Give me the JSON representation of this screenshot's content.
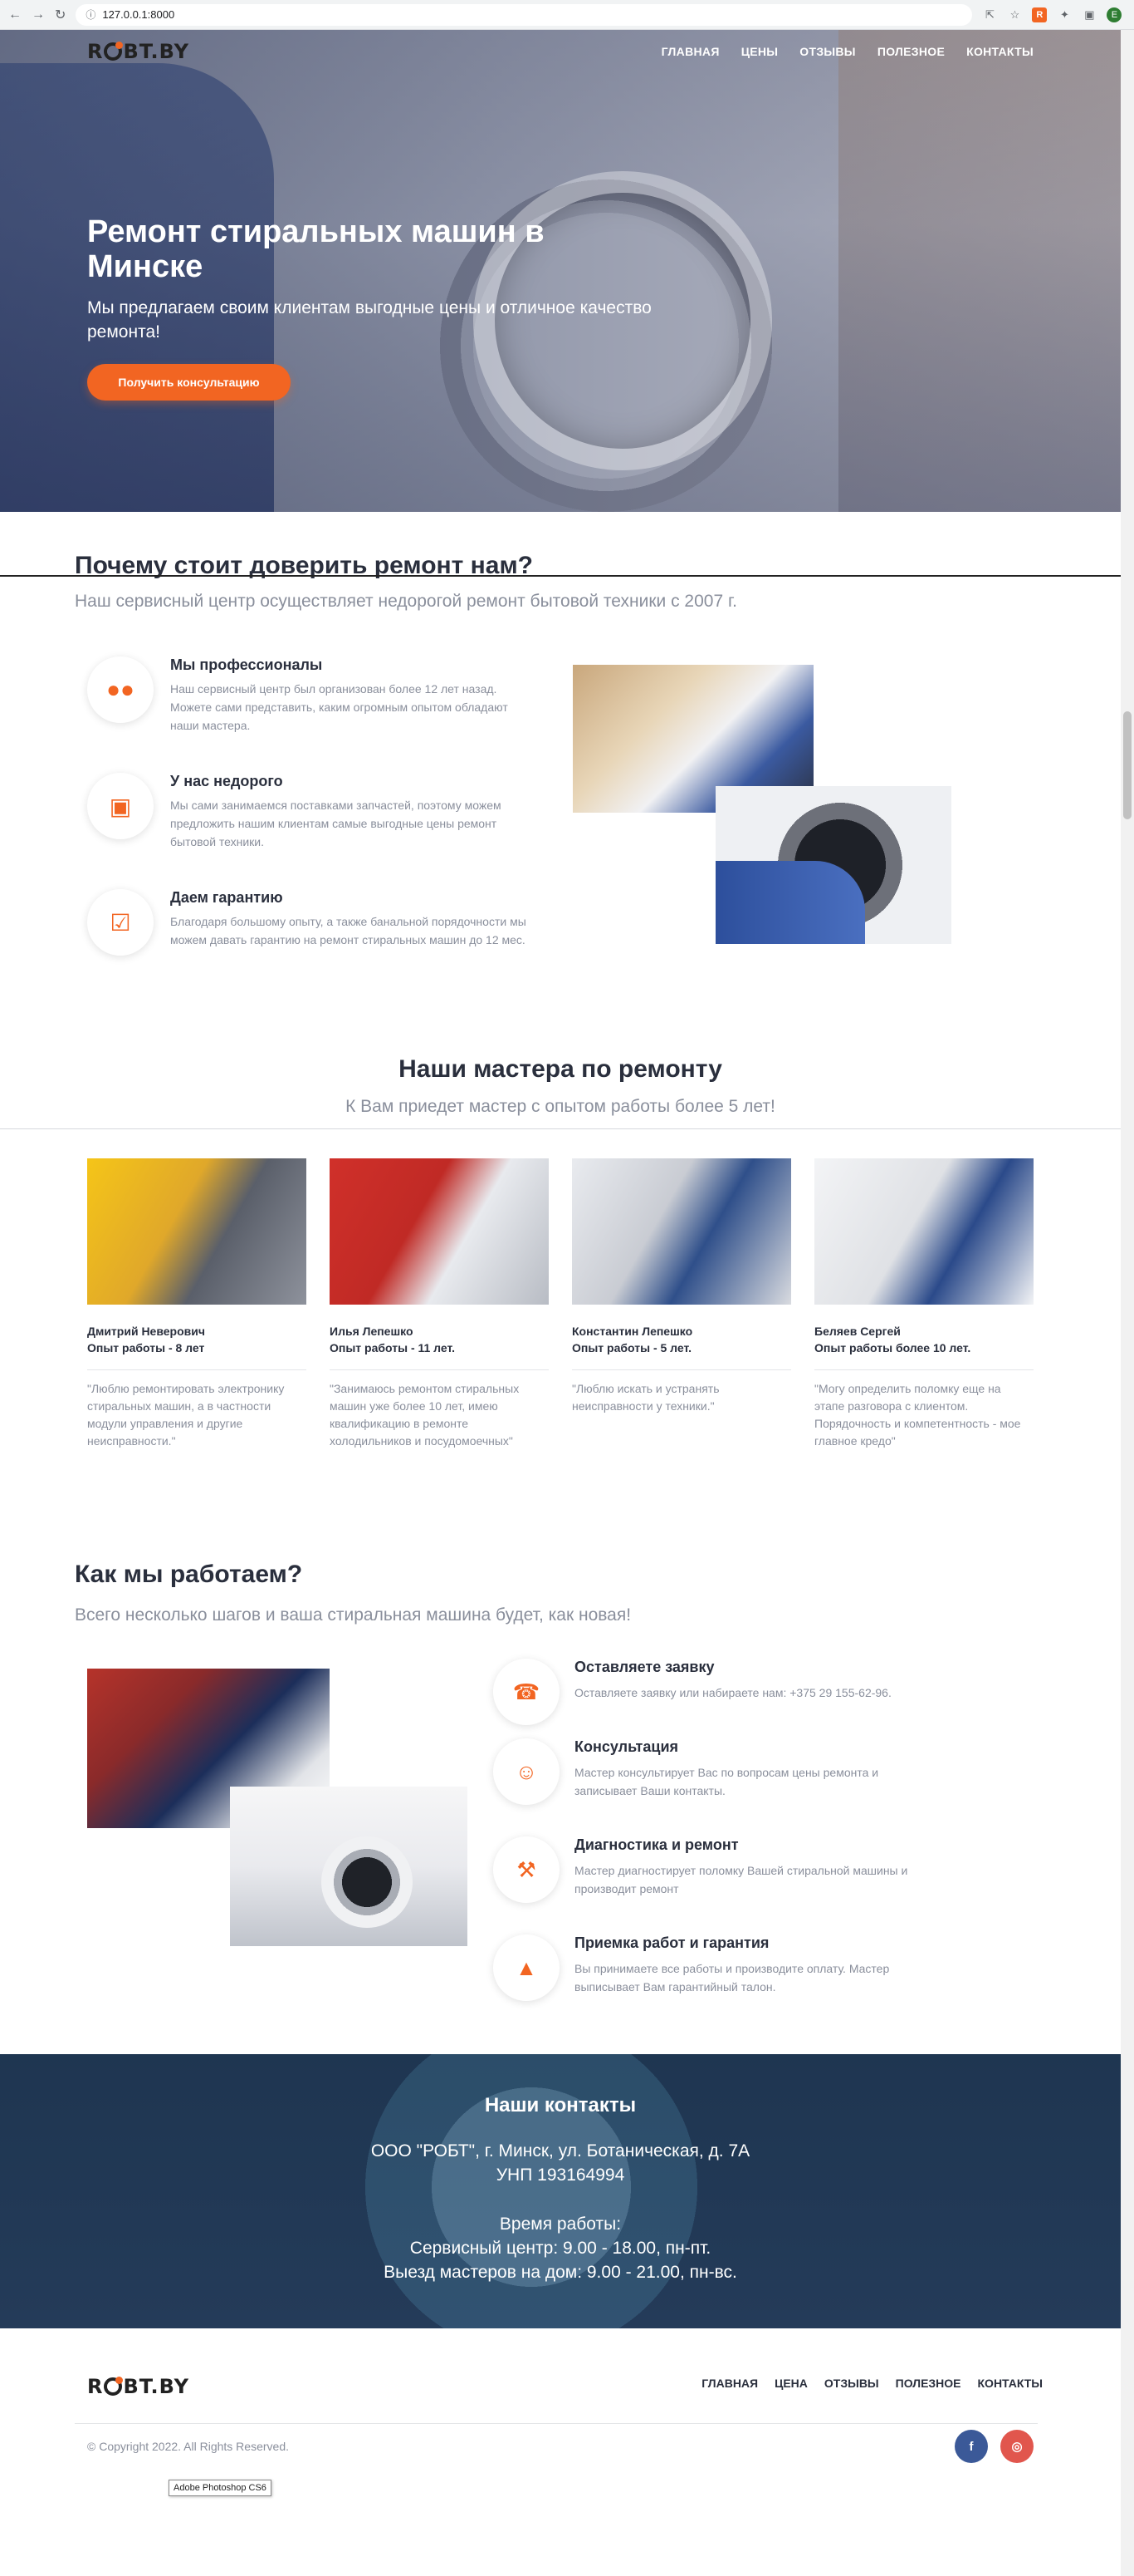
{
  "browser": {
    "url": "127.0.0.1:8000",
    "profile_initial": "E"
  },
  "nav": {
    "logo": "ROBT.BY",
    "items": [
      "ГЛАВНАЯ",
      "ЦЕНЫ",
      "ОТЗЫВЫ",
      "ПОЛЕЗНОЕ",
      "КОНТАКТЫ"
    ]
  },
  "hero": {
    "title": "Ремонт стиральных машин в Минске",
    "subtitle": "Мы предлагаем своим клиентам выгодные цены и отличное качество ремонта!",
    "cta": "Получить консультацию"
  },
  "why": {
    "title": "Почему стоит доверить ремонт нам?",
    "subtitle": "Наш сервисный центр осуществляет недорогой ремонт бытовой техники с 2007 г.",
    "features": [
      {
        "title": "Мы профессионалы",
        "text": "Наш сервисный центр был организован более 12 лет назад. Можете сами представить, каким огромным опытом обладают наши мастера.",
        "icon": "team-icon"
      },
      {
        "title": "У нас недорого",
        "text": "Мы сами занимаемся поставками запчастей, поэтому можем предложить нашим клиентам самые выгодные цены ремонт бытовой техники.",
        "icon": "money-icon"
      },
      {
        "title": "Даем гарантию",
        "text": "Благодаря большому опыту, а также банальной порядочности мы можем давать гарантию на ремонт стиральных машин до 12 мес.",
        "icon": "checkbox-icon"
      }
    ]
  },
  "masters": {
    "title": "Наши мастера по ремонту",
    "subtitle": "К Вам приедет мастер с опытом работы более 5 лет!",
    "items": [
      {
        "name": "Дмитрий Неверович",
        "experience": "Опыт работы - 8 лет",
        "quote": "\"Люблю ремонтировать электронику стиральных машин, а в частности модули управления и другие неисправности.\""
      },
      {
        "name": "Илья Лепешко",
        "experience": "Опыт работы - 11 лет.",
        "quote": "\"Занимаюсь ремонтом стиральных машин уже более 10 лет, имею квалификацию в ремонте холодильников и посудомоечных\""
      },
      {
        "name": "Константин Лепешко",
        "experience": "Опыт работы - 5 лет.",
        "quote": "\"Люблю искать и устранять неисправности у техники.\""
      },
      {
        "name": "Беляев Сергей",
        "experience": "Опыт работы более 10 лет.",
        "quote": "\"Могу определить поломку еще на этапе разговора с клиентом. Порядочность и компетентность - мое главное кредо\""
      }
    ]
  },
  "how": {
    "title": "Как мы работаем?",
    "subtitle": "Всего несколько шагов и ваша стиральная машина будет, как новая!",
    "steps": [
      {
        "title": "Оставляете заявку",
        "text": "Оставляете заявку или набираете нам: +375 29 155-62-96.",
        "icon": "phone-icon"
      },
      {
        "title": "Консультация",
        "text": "Мастер консультирует Вас по вопросам цены ремонта и записывает Ваши контакты.",
        "icon": "person-icon"
      },
      {
        "title": "Диагностика и ремонт",
        "text": "Мастер диагностирует поломку Вашей стиральной машины и производит ремонт",
        "icon": "wrench-icon"
      },
      {
        "title": "Приемка работ и гарантия",
        "text": "Вы принимаете все работы и производите оплату. Мастер выписывает Вам гарантийный талон.",
        "icon": "thumbs-up-icon"
      }
    ]
  },
  "contacts": {
    "title": "Наши контакты",
    "address": "ООО \"РОБТ\", г. Минск, ул. Ботаническая, д. 7А",
    "unp": "УНП 193164994",
    "hours_title": "Время работы:",
    "service_hours": "Сервисный центр: 9.00 - 18.00, пн-пт.",
    "visit_hours": "Выезд мастеров на дом: 9.00 - 21.00, пн-вс."
  },
  "footer": {
    "logo": "ROBT.BY",
    "menu": [
      "ГЛАВНАЯ",
      "ЦЕНА",
      "ОТЗЫВЫ",
      "ПОЛЕЗНОЕ",
      "КОНТАКТЫ"
    ],
    "copyright": "© Copyright 2022. All Rights Reserved.",
    "tooltip": "Adobe Photoshop CS6"
  },
  "colors": {
    "accent": "#f26522",
    "heading": "#2a2f3d",
    "muted": "#8a8f9c"
  }
}
